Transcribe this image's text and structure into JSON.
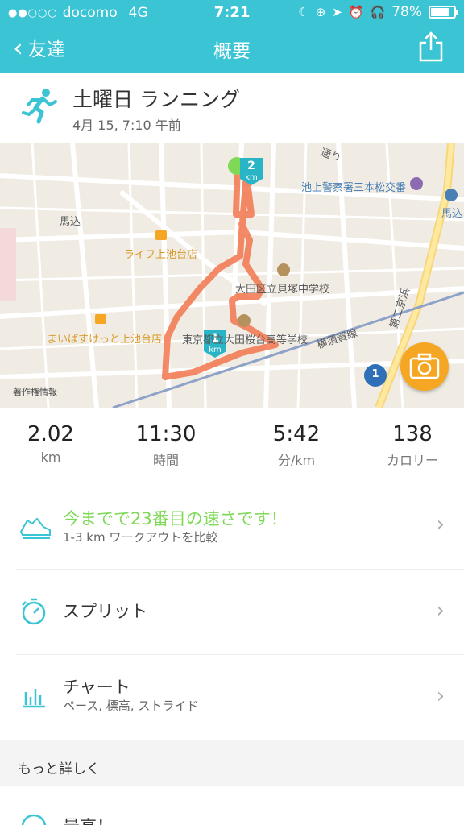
{
  "status_bar": {
    "carrier": "docomo",
    "network": "4G",
    "time": "7:21",
    "battery": "78%",
    "battery_level": 0.78
  },
  "nav": {
    "back_label": "友達",
    "title": "概要"
  },
  "activity": {
    "title": "土曜日 ランニング",
    "date": "4月 15, 7:10 午前"
  },
  "map": {
    "labels": {
      "police": "池上警察署三本松交番",
      "umagome_left": "馬込",
      "umagome_right": "馬込",
      "life_store": "ライフ上池台店",
      "school": "大田区立貝塚中学校",
      "maibasuket": "まいばすけっと上池台店",
      "high_school": "東京都立大田桜台高等学校",
      "street_top": "通り",
      "kansen": "第二京浜",
      "yokosuka": "横須賀線",
      "copyright": "著作権情報",
      "route_num": "1",
      "marker_1_num": "1",
      "marker_1_unit": "km",
      "marker_2_num": "2",
      "marker_2_unit": "km"
    },
    "route_color": "#f2764d"
  },
  "stats": [
    {
      "value": "2.02",
      "unit": "km"
    },
    {
      "value": "11:30",
      "unit": "時間"
    },
    {
      "value": "5:42",
      "unit": "分/km"
    },
    {
      "value": "138",
      "unit": "カロリー"
    }
  ],
  "rows": {
    "record_title": "今までで23番目の速さです！",
    "record_sub": "1-3 km ワークアウトを比較",
    "splits_title": "スプリット",
    "chart_title": "チャート",
    "chart_sub": "ペース, 標高, ストライド",
    "elevation_title": "最高！"
  },
  "section": {
    "more_details": "もっと詳しく"
  },
  "colors": {
    "accent": "#3bc4d4",
    "record_green": "#7ed957",
    "camera": "#f5a623"
  }
}
